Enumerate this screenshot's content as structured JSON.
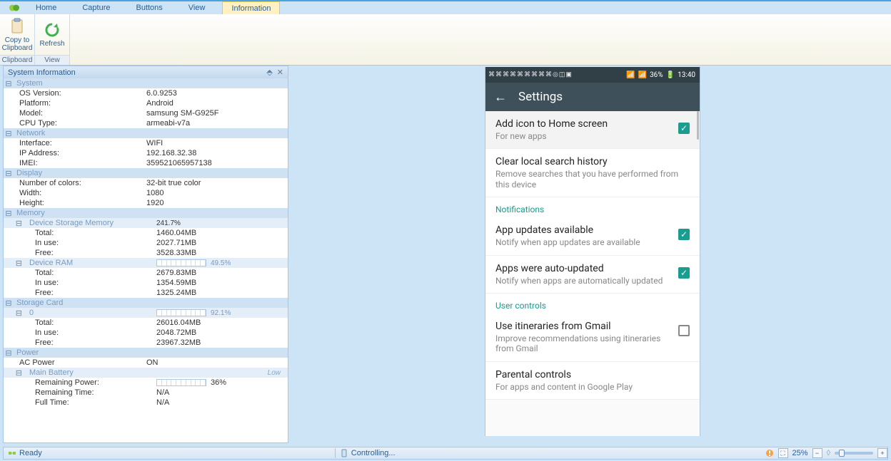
{
  "tabs": {
    "home": "Home",
    "capture": "Capture",
    "buttons": "Buttons",
    "view": "View",
    "info": "Information"
  },
  "ribbon": {
    "copy": {
      "label": "Copy to\nClipboard"
    },
    "refresh": {
      "label": "Refresh"
    },
    "g_clipboard": "Clipboard",
    "g_view": "View"
  },
  "panel": {
    "title": "System Information",
    "system": {
      "header": "System",
      "os_l": "OS Version:",
      "os_v": "6.0.9253",
      "plat_l": "Platform:",
      "plat_v": "Android",
      "model_l": "Model:",
      "model_v": "samsung SM-G925F",
      "cpu_l": "CPU Type:",
      "cpu_v": "armeabi-v7a"
    },
    "network": {
      "header": "Network",
      "if_l": "Interface:",
      "if_v": "WIFI",
      "ip_l": "IP Address:",
      "ip_v": "192.168.32.38",
      "imei_l": "IMEI:",
      "imei_v": "359521065957138"
    },
    "display": {
      "header": "Display",
      "nc_l": "Number of colors:",
      "nc_v": "32-bit true color",
      "w_l": "Width:",
      "w_v": "1080",
      "h_l": "Height:",
      "h_v": "1920"
    },
    "memory": {
      "header": "Memory",
      "dsm_header": "Device Storage Memory",
      "dsm_pct": "241.7%",
      "dsm_total_l": "Total:",
      "dsm_total_v": "1460.04MB",
      "dsm_inuse_l": "In use:",
      "dsm_inuse_v": "2027.71MB",
      "dsm_free_l": "Free:",
      "dsm_free_v": "3528.33MB",
      "ram_header": "Device RAM",
      "ram_pct": "49.5%",
      "ram_total_l": "Total:",
      "ram_total_v": "2679.83MB",
      "ram_inuse_l": "In use:",
      "ram_inuse_v": "1354.59MB",
      "ram_free_l": "Free:",
      "ram_free_v": "1325.24MB"
    },
    "storage": {
      "header": "Storage Card",
      "card0": "0",
      "card0_pct": "92.1%",
      "total_l": "Total:",
      "total_v": "26016.04MB",
      "inuse_l": "In use:",
      "inuse_v": "2048.72MB",
      "free_l": "Free:",
      "free_v": "23967.32MB"
    },
    "power": {
      "header": "Power",
      "ac_l": "AC Power",
      "ac_v": "ON",
      "mb_header": "Main Battery",
      "mb_status": "Low",
      "rp_l": "Remaining Power:",
      "rp_v": "36%",
      "rt_l": "Remaining Time:",
      "rt_v": "N/A",
      "ft_l": "Full Time:",
      "ft_v": "N/A"
    }
  },
  "device": {
    "status": {
      "battery": "36%",
      "time": "13:40"
    },
    "title": "Settings",
    "items": {
      "add_icon_t": "Add icon to Home screen",
      "add_icon_s": "For new apps",
      "clear_t": "Clear local search history",
      "clear_s": "Remove searches that you have performed from this device",
      "sect_notif": "Notifications",
      "updates_t": "App updates available",
      "updates_s": "Notify when app updates are available",
      "auto_t": "Apps were auto-updated",
      "auto_s": "Notify when apps are automatically updated",
      "sect_user": "User controls",
      "gmail_t": "Use itineraries from Gmail",
      "gmail_s": "Improve recommendations using itineraries from Gmail",
      "parental_t": "Parental controls",
      "parental_s": "For apps and content in Google Play"
    }
  },
  "statusbar": {
    "ready": "Ready",
    "controlling": "Controlling...",
    "zoom": "25%"
  }
}
